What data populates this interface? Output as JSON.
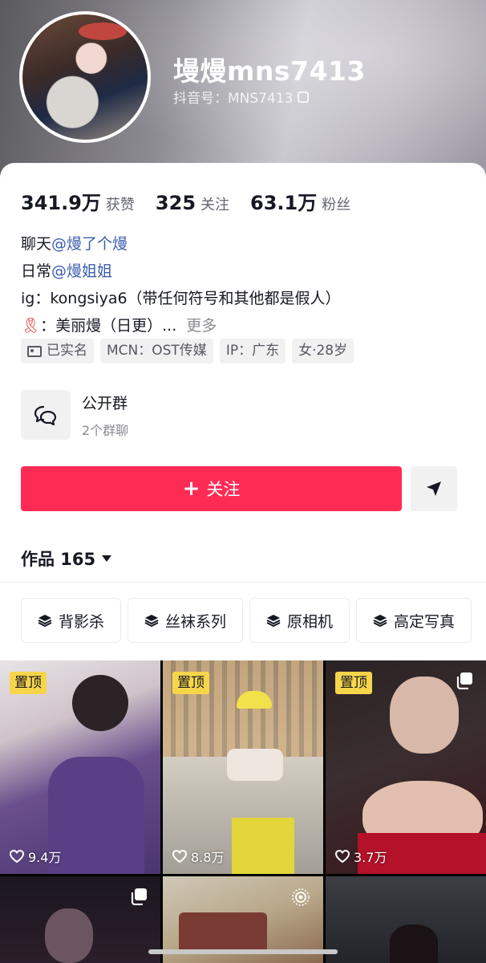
{
  "profile": {
    "nickname": "墁熳mns7413",
    "douyin_id": "抖音号：MNS7413"
  },
  "stats": [
    {
      "value": "341.9万",
      "label": "获赞"
    },
    {
      "value": "325",
      "label": "关注"
    },
    {
      "value": "63.1万",
      "label": "粉丝"
    }
  ],
  "bio": {
    "line1_prefix": "聊天",
    "line1_link": "@熳了个熳",
    "line2_prefix": "日常",
    "line2_link": "@熳姐姐",
    "line3": "ig：kongsiya6（带任何符号和其他都是假人）",
    "line4_emoji": "🎗",
    "line4_text": "：美丽熳（日更）...",
    "more": "更多"
  },
  "tags": [
    "已实名",
    "MCN：OST传媒",
    "IP：广东",
    "女·28岁"
  ],
  "group": {
    "title": "公开群",
    "subtitle": "2个群聊"
  },
  "follow_label": "关注",
  "works_label": "作品 165",
  "collections": [
    "背影杀",
    "丝袜系列",
    "原相机",
    "高定写真"
  ],
  "videos": [
    {
      "pinned": "置顶",
      "likes": "9.4万"
    },
    {
      "pinned": "置顶",
      "likes": "8.8万"
    },
    {
      "pinned": "置顶",
      "likes": "3.7万"
    }
  ],
  "colors": {
    "follow_button": "#fe2c55",
    "pin_badge": "#f7d54a",
    "link": "#3a5dae"
  }
}
